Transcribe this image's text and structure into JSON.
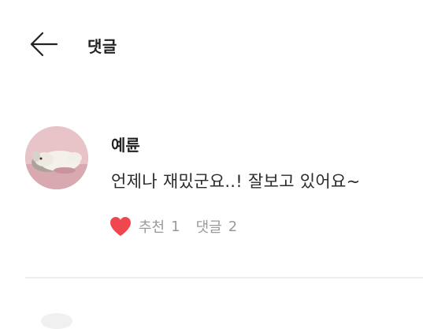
{
  "header": {
    "back_icon": "arrow-left-icon",
    "title": "댓글"
  },
  "comment": {
    "author": "예륜",
    "text": "언제나 재밌군요..! 잘보고 있어요~",
    "like_icon": "heart-icon",
    "like_color": "#f0474f",
    "like_label": "추천",
    "like_count": "1",
    "reply_label": "댓글",
    "reply_count": "2"
  },
  "colors": {
    "text": "#222222",
    "muted": "#9a9a9a",
    "divider": "#eeeeee"
  }
}
